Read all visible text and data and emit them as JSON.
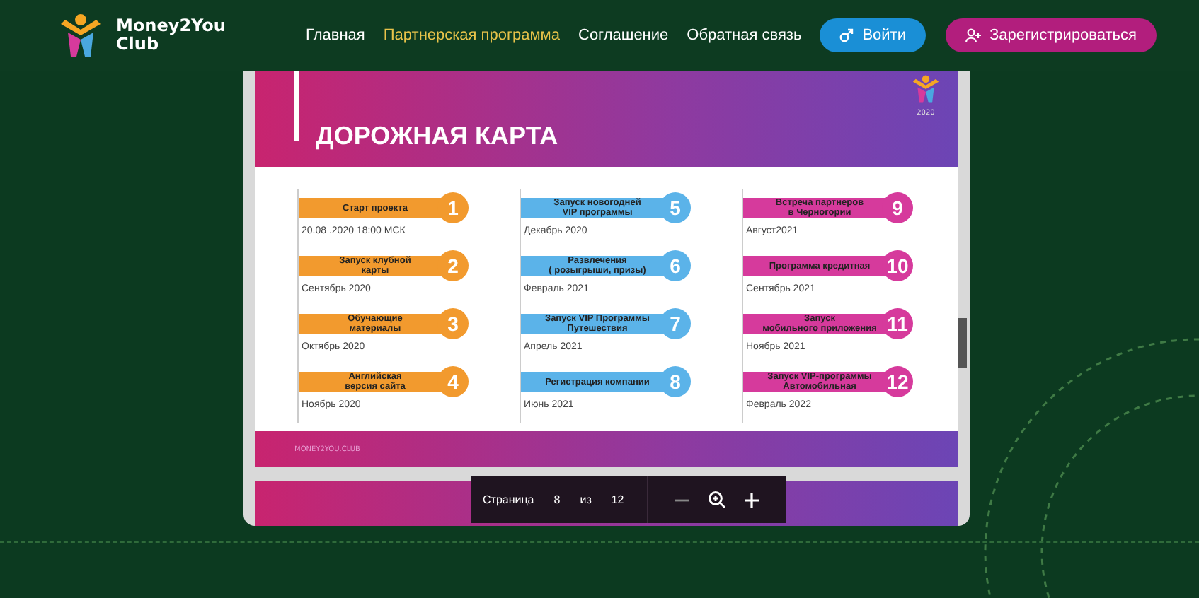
{
  "brand": {
    "name": "Money2You\nClub"
  },
  "nav": [
    {
      "label": "Главная",
      "selected": false
    },
    {
      "label": "Партнерская программа",
      "selected": true
    },
    {
      "label": "Соглашение",
      "selected": false
    },
    {
      "label": "Обратная связь",
      "selected": false
    }
  ],
  "actions": [
    {
      "label": "Войти",
      "kind": "login"
    },
    {
      "label": "Зарегистрироваться",
      "kind": "register"
    }
  ],
  "slide": {
    "title": "ДОРОЖНАЯ КАРТА",
    "year": "2020",
    "footer": "MONEY2YOU.CLUB",
    "columns": [
      {
        "color": "#f29a2e",
        "items": [
          {
            "title": "Старт проекта",
            "number": "1",
            "date": "20.08 .2020 18:00 МСК"
          },
          {
            "title": "Запуск клубной\nкарты",
            "number": "2",
            "date": "Сентябрь 2020"
          },
          {
            "title": "Обучающие\nматериалы",
            "number": "3",
            "date": "Октябрь 2020"
          },
          {
            "title": "Английская\nверсия сайта",
            "number": "4",
            "date": "Ноябрь 2020"
          }
        ]
      },
      {
        "color": "#5bb3e9",
        "items": [
          {
            "title": "Запуск новогодней\nVIP программы",
            "number": "5",
            "date": "Декабрь 2020"
          },
          {
            "title": "Развлечения\n( розыгрыши, призы)",
            "number": "6",
            "date": "Февраль 2021"
          },
          {
            "title": "Запуск VIP Программы\nПутешествия",
            "number": "7",
            "date": "Апрель 2021"
          },
          {
            "title": "Регистрация компании",
            "number": "8",
            "date": "Июнь 2021"
          }
        ]
      },
      {
        "color": "#d63a9c",
        "items": [
          {
            "title": "Встреча партнеров\nв Черногории",
            "number": "9",
            "date": "Август2021"
          },
          {
            "title": "Программа кредитная",
            "number": "10",
            "date": "Сентябрь 2021"
          },
          {
            "title": "Запуск\nмобильного приложения",
            "number": "11",
            "date": "Ноябрь  2021"
          },
          {
            "title": "Запуск VIP-программы\nАвтомобильная",
            "number": "12",
            "date": "Февраль 2022"
          }
        ]
      }
    ]
  },
  "toolbar": {
    "page_label": "Страница",
    "page": "8",
    "of": "из",
    "total": "12"
  }
}
